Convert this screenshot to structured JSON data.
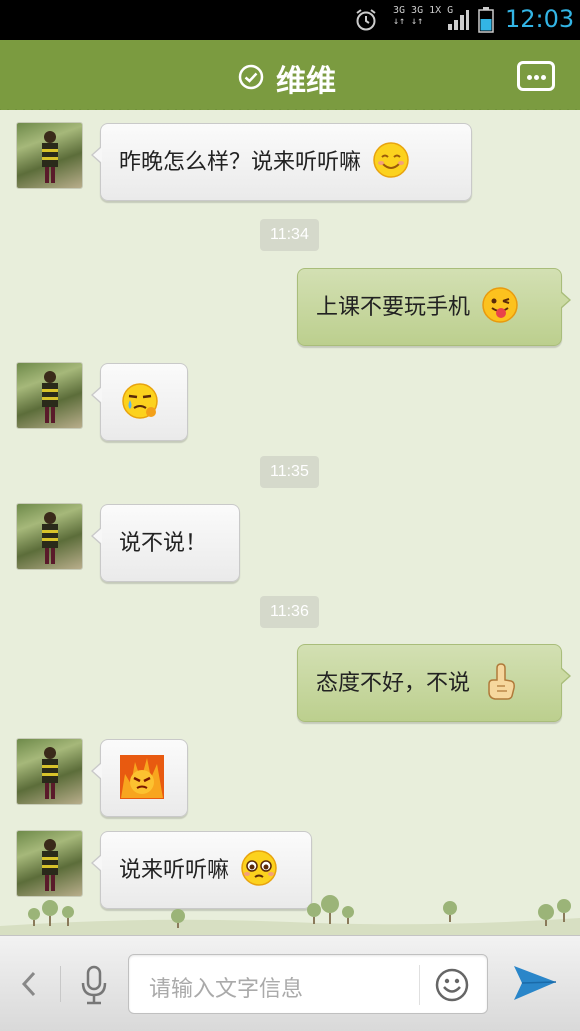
{
  "status_bar": {
    "network_top": "3G 3G 1X G",
    "network_bottom": "↓↑ ↓↑",
    "time": "12:03"
  },
  "header": {
    "title": "维维",
    "verified_icon": "check-circle-icon",
    "more_icon": "more-dots-icon"
  },
  "messages": [
    {
      "side": "left",
      "text": "昨晚怎么样？说来听听嘛",
      "emoji": "smile-emoji"
    },
    {
      "side": "time",
      "text": "11:34"
    },
    {
      "side": "right",
      "text": "上课不要玩手机",
      "emoji": "tongue-wink-emoji"
    },
    {
      "side": "left",
      "text": "",
      "emoji": "sweat-emoji"
    },
    {
      "side": "time",
      "text": "11:35"
    },
    {
      "side": "left",
      "text": "说不说！",
      "emoji": ""
    },
    {
      "side": "time",
      "text": "11:36"
    },
    {
      "side": "right",
      "text": "态度不好，不说",
      "emoji": "finger-up-emoji"
    },
    {
      "side": "left",
      "text": "",
      "emoji": "angry-fire-emoji"
    },
    {
      "side": "left",
      "text": "说来听听嘛",
      "emoji": "pleading-emoji"
    }
  ],
  "input_bar": {
    "placeholder": "请输入文字信息",
    "back_icon": "chevron-left-icon",
    "mic_icon": "microphone-icon",
    "emoji_icon": "smiley-icon",
    "send_icon": "send-arrow-icon"
  },
  "colors": {
    "header_green": "#7b9b40",
    "chat_bg": "#e8eedb",
    "right_bubble": "#c6d79d",
    "clock_blue": "#33b5e5",
    "send_blue": "#2a86c9"
  }
}
